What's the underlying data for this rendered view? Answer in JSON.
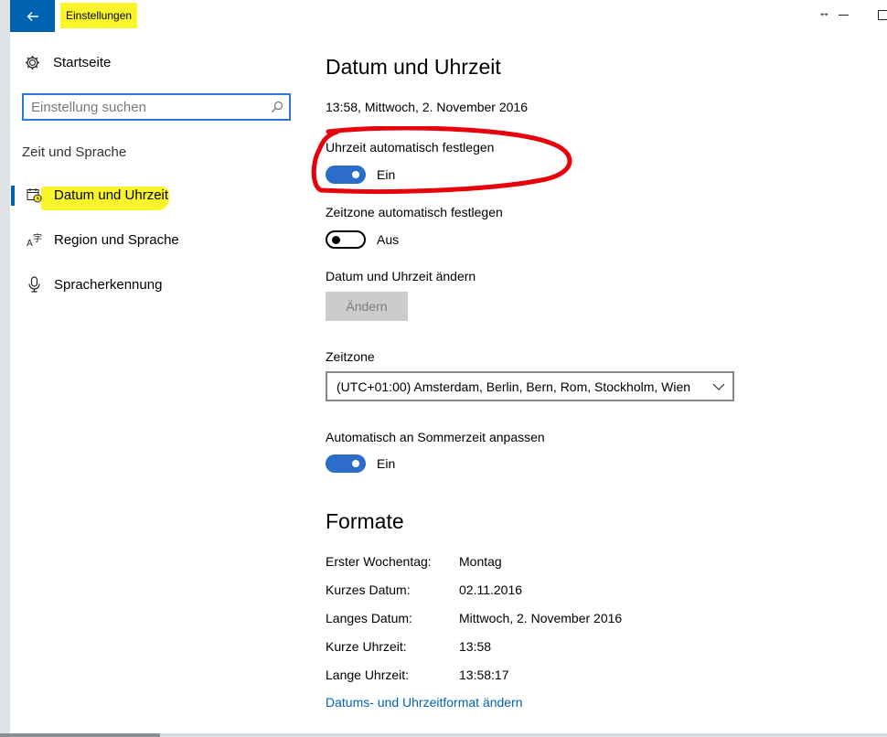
{
  "window": {
    "title": "Einstellungen",
    "back_label": "←"
  },
  "sidebar": {
    "home_label": "Startseite",
    "search_placeholder": "Einstellung suchen",
    "section_title": "Zeit und Sprache",
    "items": [
      {
        "label": "Datum und Uhrzeit",
        "icon": "calendar-clock-icon",
        "active": true
      },
      {
        "label": "Region und Sprache",
        "icon": "region-language-icon",
        "active": false
      },
      {
        "label": "Spracherkennung",
        "icon": "microphone-icon",
        "active": false
      }
    ]
  },
  "main": {
    "title": "Datum und Uhrzeit",
    "current_datetime": "13:58, Mittwoch, 2. November 2016",
    "auto_time": {
      "label": "Uhrzeit automatisch festlegen",
      "state": "Ein",
      "on": true
    },
    "auto_timezone": {
      "label": "Zeitzone automatisch festlegen",
      "state": "Aus",
      "on": false
    },
    "change_datetime": {
      "label": "Datum und Uhrzeit ändern",
      "button": "Ändern",
      "enabled": false
    },
    "timezone": {
      "label": "Zeitzone",
      "value": "(UTC+01:00) Amsterdam, Berlin, Bern, Rom, Stockholm, Wien"
    },
    "dst": {
      "label": "Automatisch an Sommerzeit anpassen",
      "state": "Ein",
      "on": true
    },
    "formats": {
      "title": "Formate",
      "rows": [
        {
          "key": "Erster Wochentag:",
          "value": "Montag"
        },
        {
          "key": "Kurzes Datum:",
          "value": "02.11.2016"
        },
        {
          "key": "Langes Datum:",
          "value": "Mittwoch, 2. November 2016"
        },
        {
          "key": "Kurze Uhrzeit:",
          "value": "13:58"
        },
        {
          "key": "Lange Uhrzeit:",
          "value": "13:58:17"
        }
      ],
      "link": "Datums- und Uhrzeitformat ändern"
    }
  },
  "colors": {
    "accent": "#0063b1",
    "toggle_on": "#2b6dc9",
    "highlight": "#f9f52a",
    "annotation": "#e8000b"
  }
}
